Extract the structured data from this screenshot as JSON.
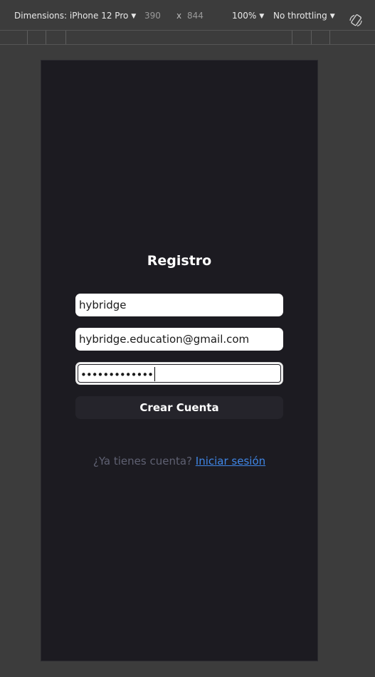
{
  "devtools": {
    "device_label": "Dimensions: iPhone 12 Pro",
    "width": "390",
    "times": "x",
    "height": "844",
    "zoom": "100%",
    "throttling": "No throttling",
    "caret": "▼",
    "rotate_icon": "rotate-icon"
  },
  "screen": {
    "title": "Registro",
    "username_value": "hybridge",
    "email_value": "hybridge.education@gmail.com",
    "password_mask": "•••••••••••••",
    "submit_label": "Crear Cuenta",
    "footer_text": "¿Ya tienes cuenta?",
    "footer_link": "Iniciar sesión",
    "colors": {
      "background": "#1c1b21",
      "link": "#3f86e6",
      "button": "#25242b"
    }
  }
}
